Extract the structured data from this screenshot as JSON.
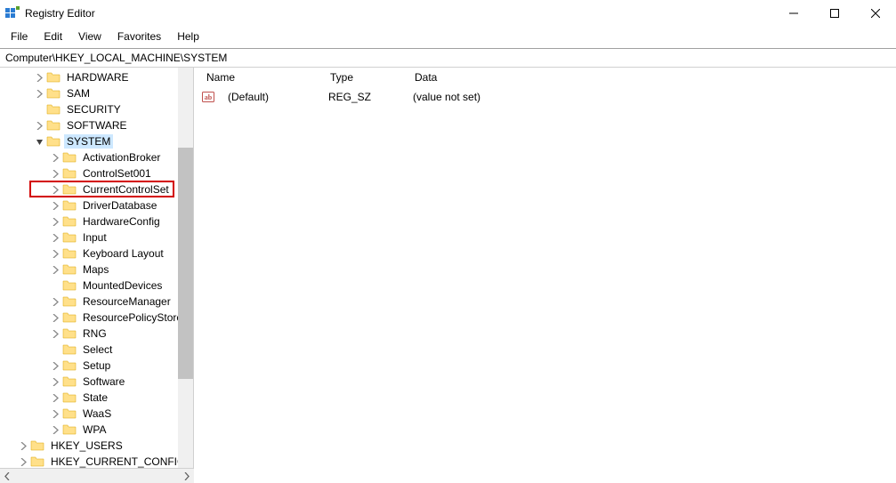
{
  "window": {
    "title": "Registry Editor"
  },
  "menu": {
    "file": "File",
    "edit": "Edit",
    "view": "View",
    "favorites": "Favorites",
    "help": "Help"
  },
  "address": "Computer\\HKEY_LOCAL_MACHINE\\SYSTEM",
  "tree": {
    "hardware": "HARDWARE",
    "sam": "SAM",
    "security": "SECURITY",
    "software": "SOFTWARE",
    "system": "SYSTEM",
    "system_children": {
      "activationbroker": "ActivationBroker",
      "controlset001": "ControlSet001",
      "currentcontrolset": "CurrentControlSet",
      "driverdatabase": "DriverDatabase",
      "hardwareconfig": "HardwareConfig",
      "input": "Input",
      "keyboardlayout": "Keyboard Layout",
      "maps": "Maps",
      "mounteddevices": "MountedDevices",
      "resourcemanager": "ResourceManager",
      "resourcepolicystore": "ResourcePolicyStore",
      "rng": "RNG",
      "select": "Select",
      "setup": "Setup",
      "software2": "Software",
      "state": "State",
      "waas": "WaaS",
      "wpa": "WPA"
    },
    "hkey_users": "HKEY_USERS",
    "hkey_current_config": "HKEY_CURRENT_CONFIG"
  },
  "list": {
    "headers": {
      "name": "Name",
      "type": "Type",
      "data": "Data"
    },
    "row0": {
      "name": "(Default)",
      "type": "REG_SZ",
      "data": "(value not set)"
    }
  }
}
